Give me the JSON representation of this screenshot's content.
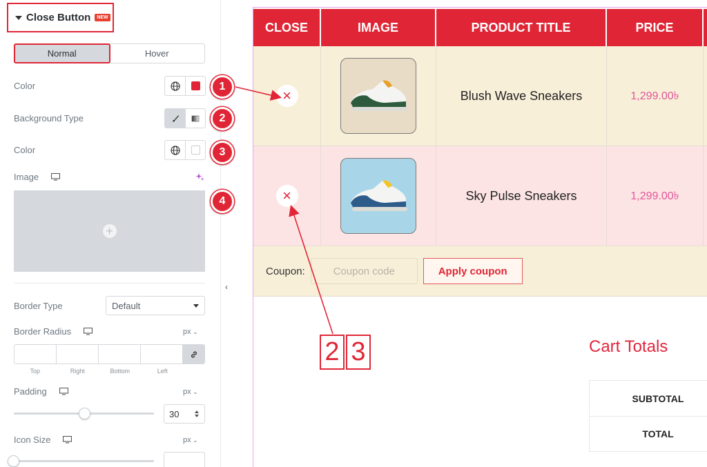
{
  "panel": {
    "section_title": "Close Button",
    "badge": "NEW",
    "tabs": [
      {
        "label": "Normal"
      },
      {
        "label": "Hover"
      }
    ],
    "color_label": "Color",
    "close_color": "#e02636",
    "background_type_label": "Background Type",
    "bg_color_label": "Color",
    "bg_color": "#ffffff",
    "image_label": "Image",
    "border_type_label": "Border Type",
    "border_type_value": "Default",
    "border_radius_label": "Border Radius",
    "radius_unit": "px",
    "dimension_labels": [
      "Top",
      "Right",
      "Bottom",
      "Left"
    ],
    "padding_label": "Padding",
    "padding_unit": "px",
    "padding_value": "30",
    "padding_fraction": 0.5,
    "icon_size_label": "Icon Size",
    "icon_size_unit": "px",
    "collapse_icon": "‹"
  },
  "markers": [
    "1",
    "2",
    "3",
    "4"
  ],
  "table": {
    "headers": [
      "CLOSE",
      "IMAGE",
      "PRODUCT TITLE",
      "PRICE"
    ],
    "rows": [
      {
        "close": "×",
        "title": "Blush Wave Sneakers",
        "price": "1,299.00৳",
        "bg": "#f8efd9",
        "img_bg": "#e8dcc6",
        "shoe_color": "#2e5a3e"
      },
      {
        "close": "×",
        "title": "Sky Pulse Sneakers",
        "price": "1,299.00৳",
        "bg": "#fde4e4",
        "img_bg": "#a8d6e8",
        "shoe_color": "#2d5b8a"
      }
    ],
    "coupon_label": "Coupon:",
    "coupon_placeholder": "Coupon code",
    "apply_label": "Apply coupon"
  },
  "callout_labels": [
    "2",
    "3"
  ],
  "cart": {
    "title": "Cart Totals",
    "rows": [
      "SUBTOTAL",
      "TOTAL"
    ]
  },
  "colors": {
    "accent": "#e02636",
    "price": "#e05598"
  }
}
